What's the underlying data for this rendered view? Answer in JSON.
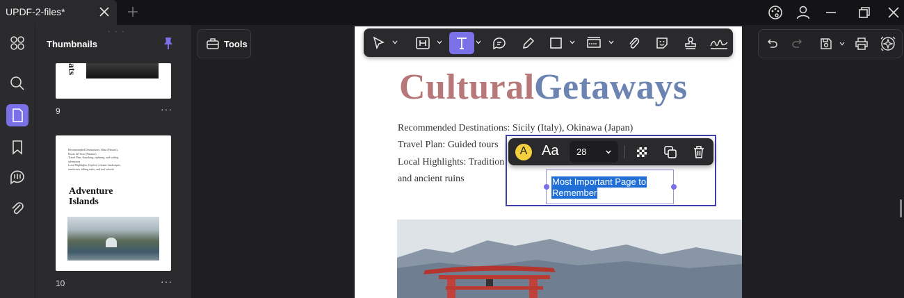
{
  "tab": {
    "title": "UPDF-2-files*"
  },
  "thumbnails": {
    "title": "Thumbnails",
    "pages": [
      {
        "number": "9",
        "title_fragment": "ats",
        "more": "···"
      },
      {
        "number": "10",
        "more": "···",
        "lines": [
          "Recommended Destinations: Maui (Hawaii),",
          "Bocas del Toro (Panama)",
          "Travel Plan: Kayaking, ziplining, and surfing",
          "adventures",
          "Local Highlights: Explore volcanic landscapes,",
          "rainforests, hiking trails, and surf schools"
        ],
        "heading_line1": "Adventure",
        "heading_line2": "Islands"
      }
    ]
  },
  "tools": {
    "label": "Tools"
  },
  "document": {
    "title_part1": "Cultural",
    "title_part2": "Getaways",
    "line1": "Recommended Destinations: Sicily (Italy), Okinawa (Japan)",
    "line2": "Travel Plan: Guided tours",
    "line3": "Local Highlights: Tradition",
    "line4": "and ancient ruins",
    "selected_line1": "Most Important Page to",
    "selected_line2": "Remember"
  },
  "text_toolbar": {
    "color_letter": "A",
    "font_label": "Aa",
    "font_size": "28"
  },
  "colors": {
    "accent": "#7a70e8",
    "title_red": "#b7787a",
    "title_blue": "#6c84b2",
    "selection_bg": "#1f6fd6",
    "text_color_swatch": "#f4d03f"
  },
  "icons": {
    "main_toolbar": [
      "select-icon",
      "highlight-icon",
      "text-icon",
      "comment-icon",
      "pencil-icon",
      "rectangle-icon",
      "text-field-icon",
      "attachment-icon",
      "sticker-icon",
      "stamp-icon",
      "signature-icon"
    ],
    "right_toolbar": [
      "undo-icon",
      "redo-icon",
      "save-icon",
      "print-icon",
      "ai-assistant-icon"
    ],
    "rail": [
      "organize-icon",
      "search-icon",
      "thumbnails-icon",
      "bookmark-icon",
      "comments-icon",
      "attachments-icon"
    ]
  }
}
